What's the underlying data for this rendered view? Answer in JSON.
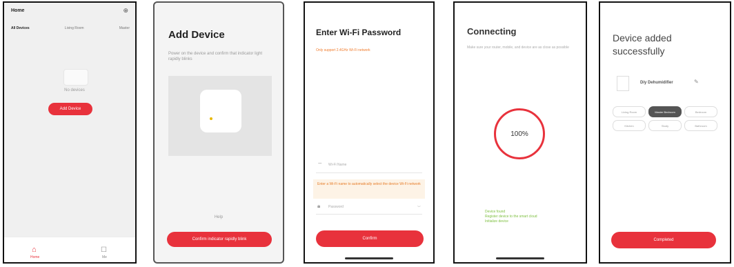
{
  "screen1": {
    "home_title": "Home",
    "add_icon": "plus",
    "tabs": [
      "All Devices",
      "Living Room",
      "Master"
    ],
    "no_device_text": "No devices",
    "add_device_btn": "Add Device",
    "tabbar": {
      "home_label": "Home",
      "me_label": "Me"
    }
  },
  "screen2": {
    "title": "Add Device",
    "desc": "Power on the device and confirm that indicator light rapidly blinks",
    "help": "Help",
    "confirm_btn": "Confirm indicator rapidly blink"
  },
  "screen3": {
    "title": "Enter Wi-Fi Password",
    "warning": "Only support 2.4GHz Wi-Fi network",
    "wifi_placeholder": "Wi-Fi Name",
    "tip": "Enter a Wi-Fi name to automatically select the device Wi-Fi network",
    "password_placeholder": "Password",
    "confirm_btn": "Confirm"
  },
  "screen4": {
    "title": "Connecting",
    "desc": "Make sure your router, mobile, and device are as close as possible",
    "progress": "100%",
    "steps": [
      "Device found",
      "Register device to the smart cloud",
      "Initialize device"
    ]
  },
  "screen5": {
    "title_line1": "Device added",
    "title_line2": "successfully",
    "device_name": "Diy Dehumidifier",
    "rooms": [
      "Living Room",
      "Master Bedroom",
      "Bedroom",
      "Kitchen",
      "Study",
      "Bathroom"
    ],
    "selected_room": "Master Bedroom",
    "completed_btn": "Completed"
  }
}
